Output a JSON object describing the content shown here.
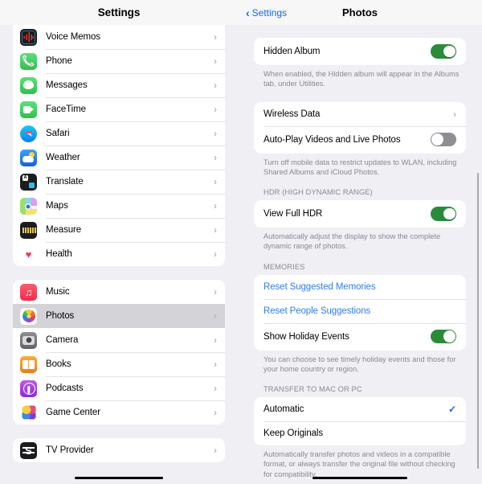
{
  "left_pane": {
    "nav": {
      "title": "Settings"
    },
    "groups": [
      {
        "id": "group-apps-1",
        "items": [
          {
            "label": "Voice Memos",
            "icon": "voice-memos-icon",
            "accessory": "chevron-right-icon",
            "selected": false
          },
          {
            "label": "Phone",
            "icon": "phone-icon",
            "accessory": "chevron-right-icon",
            "selected": false
          },
          {
            "label": "Messages",
            "icon": "messages-icon",
            "accessory": "chevron-right-icon",
            "selected": false
          },
          {
            "label": "FaceTime",
            "icon": "facetime-icon",
            "accessory": "chevron-right-icon",
            "selected": false
          },
          {
            "label": "Safari",
            "icon": "safari-icon",
            "accessory": "chevron-right-icon",
            "selected": false
          },
          {
            "label": "Weather",
            "icon": "weather-icon",
            "accessory": "chevron-right-icon",
            "selected": false
          },
          {
            "label": "Translate",
            "icon": "translate-icon",
            "accessory": "chevron-right-icon",
            "selected": false
          },
          {
            "label": "Maps",
            "icon": "maps-icon",
            "accessory": "chevron-right-icon",
            "selected": false
          },
          {
            "label": "Measure",
            "icon": "measure-icon",
            "accessory": "chevron-right-icon",
            "selected": false
          },
          {
            "label": "Health",
            "icon": "health-icon",
            "accessory": "chevron-right-icon",
            "selected": false
          }
        ]
      },
      {
        "id": "group-apps-2",
        "items": [
          {
            "label": "Music",
            "icon": "music-icon",
            "accessory": "chevron-right-icon",
            "selected": false
          },
          {
            "label": "Photos",
            "icon": "photos-icon",
            "accessory": "chevron-right-icon",
            "selected": true
          },
          {
            "label": "Camera",
            "icon": "camera-icon",
            "accessory": "chevron-right-icon",
            "selected": false
          },
          {
            "label": "Books",
            "icon": "books-icon",
            "accessory": "chevron-right-icon",
            "selected": false
          },
          {
            "label": "Podcasts",
            "icon": "podcasts-icon",
            "accessory": "chevron-right-icon",
            "selected": false
          },
          {
            "label": "Game Center",
            "icon": "game-center-icon",
            "accessory": "chevron-right-icon",
            "selected": false
          }
        ]
      },
      {
        "id": "group-apps-3",
        "items": [
          {
            "label": "TV Provider",
            "icon": "tv-provider-icon",
            "accessory": "chevron-right-icon",
            "selected": false
          }
        ]
      }
    ]
  },
  "right_pane": {
    "nav": {
      "back_label": "Settings",
      "back_icon": "chevron-left-icon",
      "title": "Photos"
    },
    "hidden_album": {
      "label": "Hidden Album",
      "toggle_state": "on",
      "footer": "When enabled, the Hidden album will appear in the Albums tab, under Utilities."
    },
    "wireless": {
      "wireless_data_label": "Wireless Data",
      "wireless_data_accessory": "chevron-right-icon",
      "autoplay_label": "Auto-Play Videos and Live Photos",
      "autoplay_toggle_state": "off",
      "footer": "Turn off mobile data to restrict updates to WLAN, including Shared Albums and iCloud Photos."
    },
    "hdr": {
      "section_title": "HDR (HIGH DYNAMIC RANGE)",
      "view_full_hdr_label": "View Full HDR",
      "view_full_hdr_toggle_state": "on",
      "footer": "Automatically adjust the display to show the complete dynamic range of photos."
    },
    "memories": {
      "section_title": "MEMORIES",
      "reset_suggested_label": "Reset Suggested Memories",
      "reset_people_label": "Reset People Suggestions",
      "show_holiday_label": "Show Holiday Events",
      "show_holiday_toggle_state": "on",
      "footer": "You can choose to see timely holiday events and those for your home country or region."
    },
    "transfer": {
      "section_title": "TRANSFER TO MAC OR PC",
      "automatic_label": "Automatic",
      "automatic_selected": true,
      "automatic_accessory": "checkmark-icon",
      "keep_originals_label": "Keep Originals",
      "keep_originals_selected": false,
      "footer": "Automatically transfer photos and videos in a compatible format, or always transfer the original file without checking for compatibility."
    }
  },
  "colors": {
    "accent_blue": "#0a69f5",
    "link_blue": "#2f7de8",
    "toggle_on_green": "#2a8c3a",
    "toggle_off_gray": "#8e8e93",
    "checkmark_blue": "#1a5de8",
    "group_bg": "#efeff4",
    "card_bg": "#ffffff",
    "selected_row": "#d3d3d8"
  }
}
